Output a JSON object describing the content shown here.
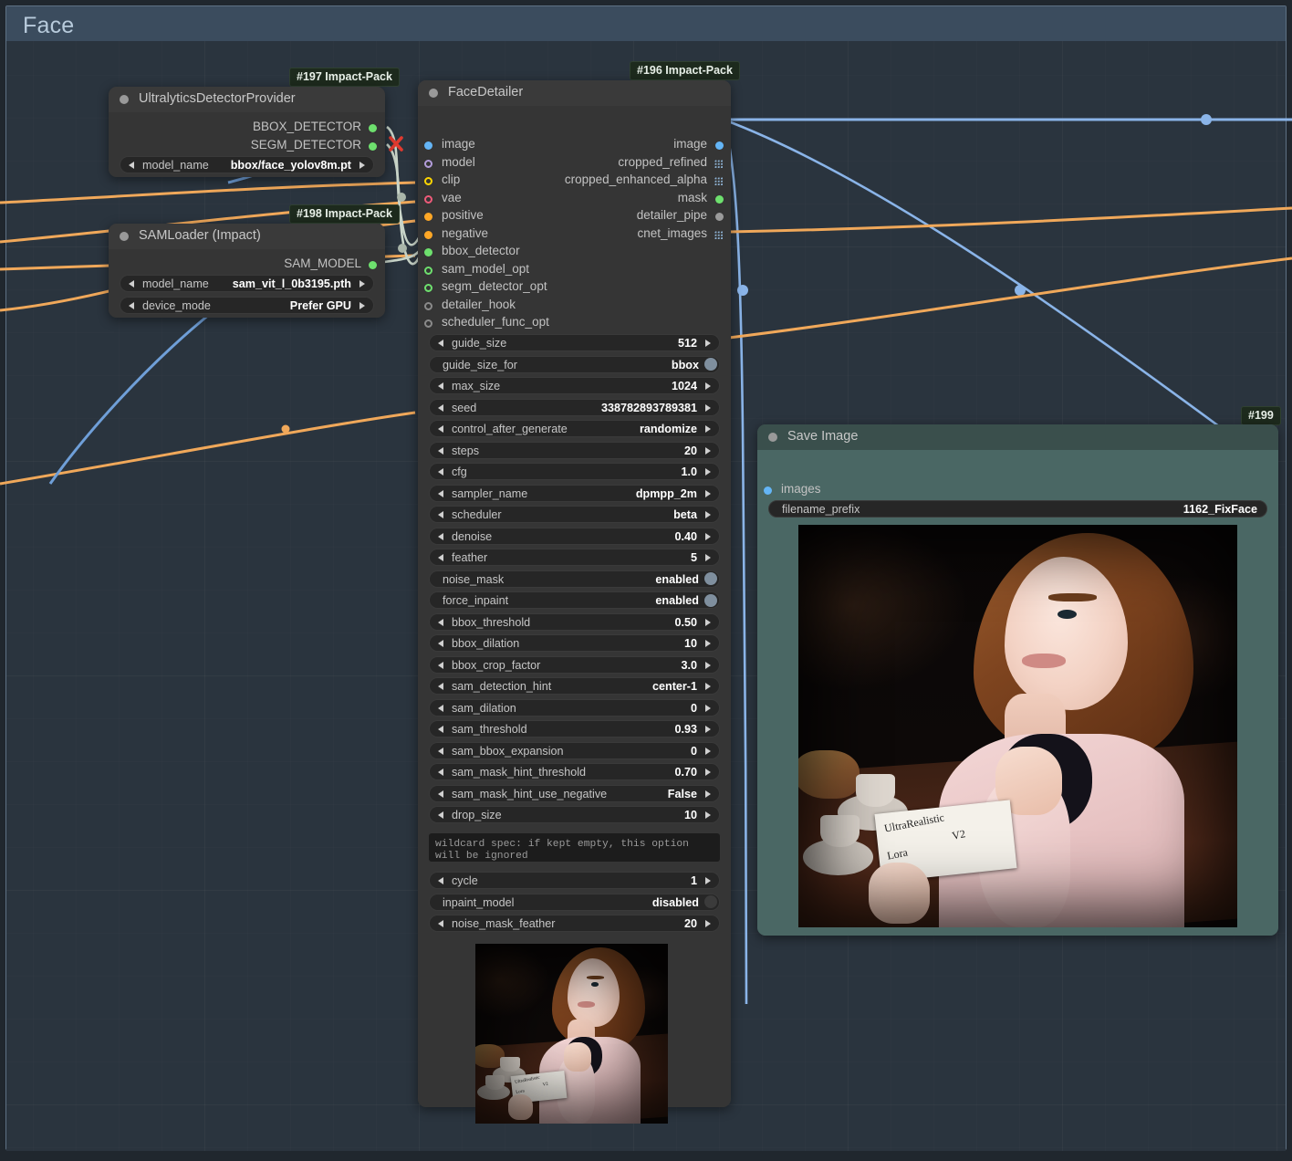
{
  "group": {
    "title": "Face"
  },
  "nodes": {
    "ultralytics": {
      "badge": "#197 Impact-Pack",
      "title": "UltralyticsDetectorProvider",
      "outputs": [
        {
          "name": "BBOX_DETECTOR",
          "color": "#6ee06e"
        },
        {
          "name": "SEGM_DETECTOR",
          "color": "#6ee06e"
        }
      ],
      "widgets": [
        {
          "name": "model_name",
          "value": "bbox/face_yolov8m.pt",
          "type": "combo"
        }
      ]
    },
    "samloader": {
      "badge": "#198 Impact-Pack",
      "title": "SAMLoader (Impact)",
      "outputs": [
        {
          "name": "SAM_MODEL",
          "color": "#6ee06e"
        }
      ],
      "widgets": [
        {
          "name": "model_name",
          "value": "sam_vit_l_0b3195.pth",
          "type": "combo"
        },
        {
          "name": "device_mode",
          "value": "Prefer GPU",
          "type": "combo"
        }
      ]
    },
    "facedetailer": {
      "badge": "#196 Impact-Pack",
      "title": "FaceDetailer",
      "inputs": [
        {
          "name": "image",
          "color": "#64b5f6",
          "style": "dot"
        },
        {
          "name": "model",
          "color": "#b39ddb",
          "style": "ring"
        },
        {
          "name": "clip",
          "color": "#ffd600",
          "style": "ring"
        },
        {
          "name": "vae",
          "color": "#ef5b79",
          "style": "ring"
        },
        {
          "name": "positive",
          "color": "#ffa726",
          "style": "dot"
        },
        {
          "name": "negative",
          "color": "#ffa726",
          "style": "dot"
        },
        {
          "name": "bbox_detector",
          "color": "#6ee06e",
          "style": "dot"
        },
        {
          "name": "sam_model_opt",
          "color": "#6ee06e",
          "style": "ring"
        },
        {
          "name": "segm_detector_opt",
          "color": "#6ee06e",
          "style": "ring"
        },
        {
          "name": "detailer_hook",
          "color": "#8a8a8a",
          "style": "ring"
        },
        {
          "name": "scheduler_func_opt",
          "color": "#8a8a8a",
          "style": "ring"
        }
      ],
      "outputs": [
        {
          "name": "image",
          "color": "#64b5f6",
          "style": "dot"
        },
        {
          "name": "cropped_refined",
          "color": "#8fb4d6",
          "style": "grid"
        },
        {
          "name": "cropped_enhanced_alpha",
          "color": "#8fb4d6",
          "style": "grid"
        },
        {
          "name": "mask",
          "color": "#6ee06e",
          "style": "dot"
        },
        {
          "name": "detailer_pipe",
          "color": "#9a9a9a",
          "style": "dot"
        },
        {
          "name": "cnet_images",
          "color": "#8fb4d6",
          "style": "grid"
        }
      ],
      "widgets": [
        {
          "name": "guide_size",
          "value": "512",
          "type": "number"
        },
        {
          "name": "guide_size_for",
          "value": "bbox",
          "type": "toggle",
          "on": true
        },
        {
          "name": "max_size",
          "value": "1024",
          "type": "number"
        },
        {
          "name": "seed",
          "value": "338782893789381",
          "type": "number"
        },
        {
          "name": "control_after_generate",
          "value": "randomize",
          "type": "combo"
        },
        {
          "name": "steps",
          "value": "20",
          "type": "number"
        },
        {
          "name": "cfg",
          "value": "1.0",
          "type": "number"
        },
        {
          "name": "sampler_name",
          "value": "dpmpp_2m",
          "type": "combo"
        },
        {
          "name": "scheduler",
          "value": "beta",
          "type": "combo"
        },
        {
          "name": "denoise",
          "value": "0.40",
          "type": "number"
        },
        {
          "name": "feather",
          "value": "5",
          "type": "number"
        },
        {
          "name": "noise_mask",
          "value": "enabled",
          "type": "toggle",
          "on": true
        },
        {
          "name": "force_inpaint",
          "value": "enabled",
          "type": "toggle",
          "on": true
        },
        {
          "name": "bbox_threshold",
          "value": "0.50",
          "type": "number"
        },
        {
          "name": "bbox_dilation",
          "value": "10",
          "type": "number"
        },
        {
          "name": "bbox_crop_factor",
          "value": "3.0",
          "type": "number"
        },
        {
          "name": "sam_detection_hint",
          "value": "center-1",
          "type": "combo"
        },
        {
          "name": "sam_dilation",
          "value": "0",
          "type": "number"
        },
        {
          "name": "sam_threshold",
          "value": "0.93",
          "type": "number"
        },
        {
          "name": "sam_bbox_expansion",
          "value": "0",
          "type": "number"
        },
        {
          "name": "sam_mask_hint_threshold",
          "value": "0.70",
          "type": "number"
        },
        {
          "name": "sam_mask_hint_use_negative",
          "value": "False",
          "type": "combo"
        },
        {
          "name": "drop_size",
          "value": "10",
          "type": "number"
        }
      ],
      "wildcard_text": "wildcard spec: if kept empty, this option will be ignored",
      "widgets_after": [
        {
          "name": "cycle",
          "value": "1",
          "type": "number"
        },
        {
          "name": "inpaint_model",
          "value": "disabled",
          "type": "toggle",
          "on": false
        },
        {
          "name": "noise_mask_feather",
          "value": "20",
          "type": "number"
        }
      ]
    },
    "saveimage": {
      "badge": "#199",
      "title": "Save Image",
      "inputs": [
        {
          "name": "images",
          "color": "#64b5f6",
          "style": "dot"
        }
      ],
      "widgets": [
        {
          "name": "filename_prefix",
          "value": "1162_FixFace",
          "type": "text"
        }
      ]
    }
  },
  "photo": {
    "card_line1": "UltraRealistic",
    "card_line2": "Lora",
    "card_line3": "V2"
  },
  "colors": {
    "canvas_bg": "#20272e",
    "group_bg": "#2a343e",
    "group_header": "#3b4c5e",
    "node_bg": "#353535",
    "node_header": "#333333",
    "save_node_bg": "#3f5a57",
    "wire_image": "#8ab4e8",
    "wire_cond": "#f0a85a",
    "wire_detector": "#c8d4c8"
  }
}
